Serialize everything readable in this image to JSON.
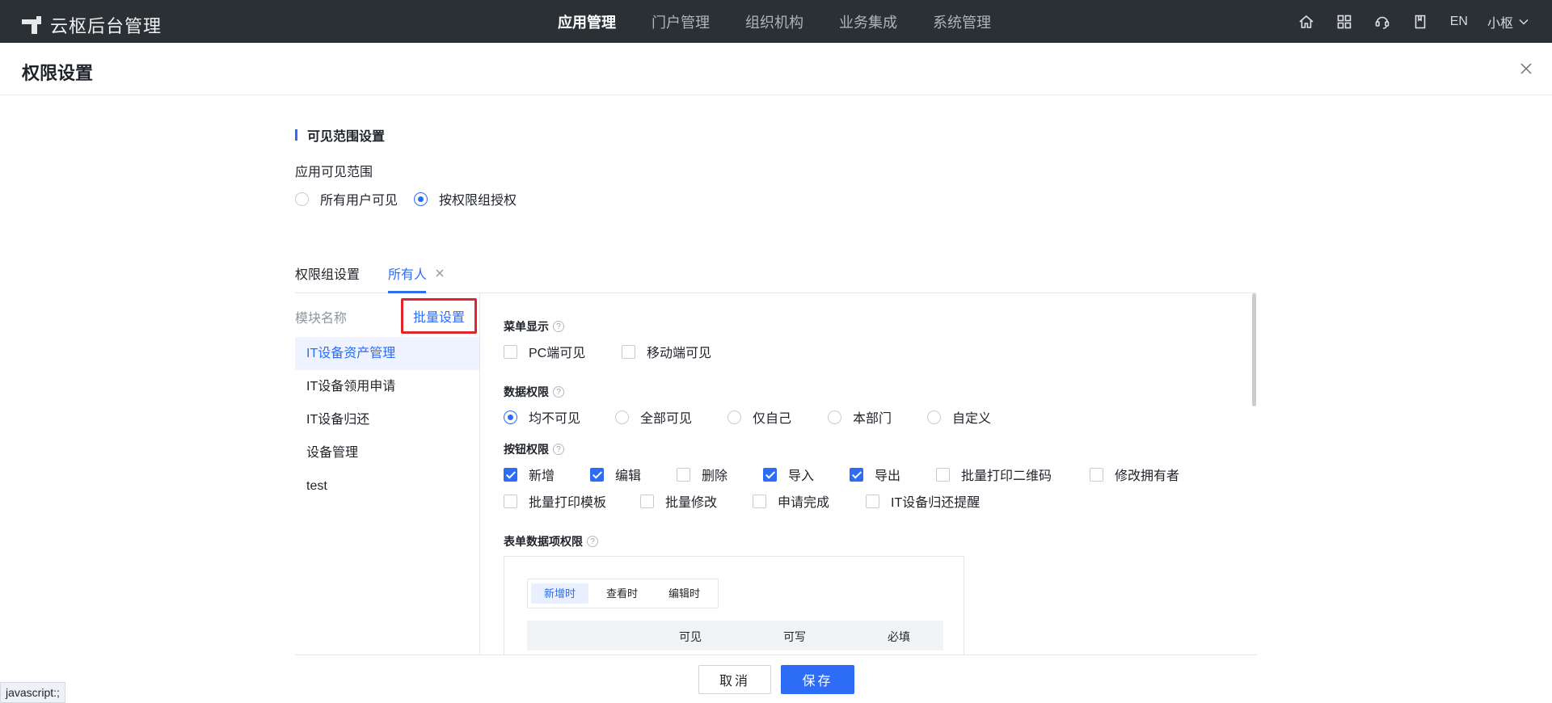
{
  "app": {
    "brand": "云枢后台管理",
    "nav": [
      {
        "label": "应用管理",
        "active": true
      },
      {
        "label": "门户管理",
        "active": false
      },
      {
        "label": "组织机构",
        "active": false
      },
      {
        "label": "业务集成",
        "active": false
      },
      {
        "label": "系统管理",
        "active": false
      }
    ],
    "lang": "EN",
    "user": "小枢",
    "icons": [
      "home-icon",
      "grid-icon",
      "headset-icon",
      "book-icon"
    ]
  },
  "page": {
    "title": "权限设置"
  },
  "visibility": {
    "section_title": "可见范围设置",
    "label": "应用可见范围",
    "options": [
      {
        "label": "所有用户可见",
        "selected": false
      },
      {
        "label": "按权限组授权",
        "selected": true
      }
    ]
  },
  "tabs": [
    {
      "label": "权限组设置",
      "active": false
    },
    {
      "label": "所有人",
      "active": true
    }
  ],
  "modules": {
    "header": "模块名称",
    "batch_label": "批量设置",
    "items": [
      {
        "label": "IT设备资产管理",
        "active": true
      },
      {
        "label": "IT设备领用申请",
        "active": false
      },
      {
        "label": "IT设备归还",
        "active": false
      },
      {
        "label": "设备管理",
        "active": false
      },
      {
        "label": "test",
        "active": false
      }
    ]
  },
  "detail": {
    "menu_display": {
      "title": "菜单显示",
      "options": [
        {
          "label": "PC端可见",
          "checked": false
        },
        {
          "label": "移动端可见",
          "checked": false
        }
      ]
    },
    "data_permission": {
      "title": "数据权限",
      "options": [
        {
          "label": "均不可见",
          "selected": true
        },
        {
          "label": "全部可见",
          "selected": false
        },
        {
          "label": "仅自己",
          "selected": false
        },
        {
          "label": "本部门",
          "selected": false
        },
        {
          "label": "自定义",
          "selected": false
        }
      ]
    },
    "button_permission": {
      "title": "按钮权限",
      "options": [
        {
          "label": "新增",
          "checked": true
        },
        {
          "label": "编辑",
          "checked": true
        },
        {
          "label": "删除",
          "checked": false
        },
        {
          "label": "导入",
          "checked": true
        },
        {
          "label": "导出",
          "checked": true
        },
        {
          "label": "批量打印二维码",
          "checked": false
        },
        {
          "label": "修改拥有者",
          "checked": false
        },
        {
          "label": "批量打印模板",
          "checked": false
        },
        {
          "label": "批量修改",
          "checked": false
        },
        {
          "label": "申请完成",
          "checked": false
        },
        {
          "label": "IT设备归还提醒",
          "checked": false
        }
      ]
    },
    "form_permission": {
      "title": "表单数据项权限",
      "modes": [
        {
          "label": "新增时",
          "active": true
        },
        {
          "label": "查看时",
          "active": false
        },
        {
          "label": "编辑时",
          "active": false
        }
      ],
      "columns": [
        "可见",
        "可写",
        "必填"
      ]
    }
  },
  "footer": {
    "cancel": "取消",
    "save": "保存"
  },
  "status_bar": "javascript:;",
  "colors": {
    "primary": "#2d6cf5",
    "topbar": "#2b3034",
    "highlight": "#e0262b"
  }
}
